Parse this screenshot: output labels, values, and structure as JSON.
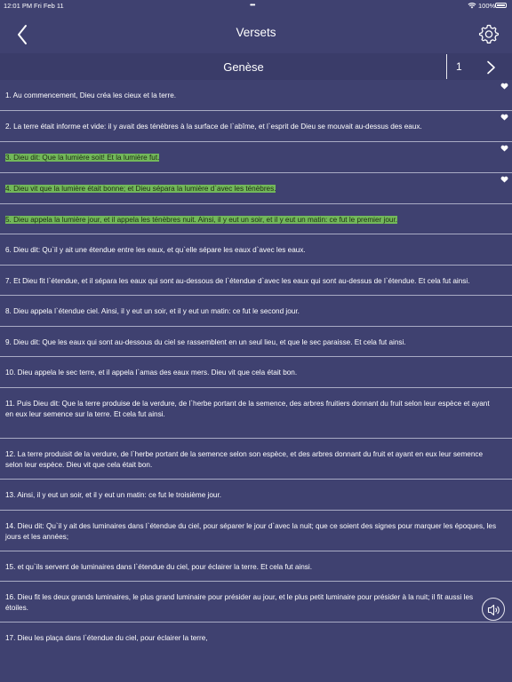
{
  "status_bar": {
    "time": "12:01 PM",
    "date": "Fri Feb 11",
    "battery": "100%"
  },
  "header": {
    "title": "Versets",
    "icons": {
      "back": "chevron-left-icon",
      "settings": "gear-icon"
    }
  },
  "selector": {
    "book": "Genèse",
    "chapter": "1",
    "next_icon": "chevron-right-icon"
  },
  "colors": {
    "background": "#3f4170",
    "highlight": "#72b85a",
    "divider": "#a9abc4"
  },
  "verses": [
    {
      "text": "1. Au commencement, Dieu créa les cieux et la terre.",
      "favorite": true,
      "highlighted": false
    },
    {
      "text": "2. La terre était informe et vide: il y avait des ténèbres à la surface de l`abîme, et l`esprit de Dieu se mouvait au-dessus des eaux.",
      "favorite": true,
      "highlighted": false
    },
    {
      "text": "3. Dieu dit: Que la lumière soit! Et la lumière fut.",
      "favorite": true,
      "highlighted": true
    },
    {
      "text": "4. Dieu vit que la lumière était bonne; et Dieu sépara la lumière d`avec les ténèbres.",
      "favorite": true,
      "highlighted": true
    },
    {
      "text": "5. Dieu appela la lumière jour, et il appela les ténèbres nuit. Ainsi, il y eut un soir, et il y eut un matin: ce fut le premier jour.",
      "favorite": false,
      "highlighted": true
    },
    {
      "text": "6. Dieu dit: Qu`il y ait une étendue entre les eaux, et qu`elle sépare les eaux d`avec les eaux.",
      "favorite": false,
      "highlighted": false
    },
    {
      "text": "7. Et Dieu fit l`étendue, et il sépara les eaux qui sont au-dessous de l`étendue d`avec les eaux qui sont au-dessus de l`étendue. Et cela fut ainsi.",
      "favorite": false,
      "highlighted": false
    },
    {
      "text": "8. Dieu appela l`étendue ciel. Ainsi, il y eut un soir, et il y eut un matin: ce fut le second jour.",
      "favorite": false,
      "highlighted": false
    },
    {
      "text": "9. Dieu dit: Que les eaux qui sont au-dessous du ciel se rassemblent en un seul lieu, et que le sec paraisse. Et cela fut ainsi.",
      "favorite": false,
      "highlighted": false
    },
    {
      "text": "10. Dieu appela le sec terre, et il appela l`amas des eaux mers. Dieu vit que cela était bon.",
      "favorite": false,
      "highlighted": false
    },
    {
      "text": "11. Puis Dieu dit: Que la terre produise de la verdure, de l`herbe portant de la semence, des arbres fruitiers donnant du fruit selon leur espèce et ayant en eux leur semence sur la terre. Et cela fut ainsi.",
      "favorite": false,
      "highlighted": false
    },
    {
      "text": "12. La terre produisit de la verdure, de l`herbe portant de la semence selon son espèce, et des arbres donnant du fruit et ayant en eux leur semence selon leur espèce. Dieu vit que cela était bon.",
      "favorite": false,
      "highlighted": false
    },
    {
      "text": "13. Ainsi, il y eut un soir, et il y eut un matin: ce fut le troisième jour.",
      "favorite": false,
      "highlighted": false
    },
    {
      "text": "14. Dieu dit: Qu`il y ait des luminaires dans l`étendue du ciel, pour séparer le jour d`avec la nuit; que ce soient des signes pour marquer les époques, les jours et les années;",
      "favorite": false,
      "highlighted": false
    },
    {
      "text": "15. et qu`ils servent de luminaires dans l`étendue du ciel, pour éclairer la terre. Et cela fut ainsi.",
      "favorite": false,
      "highlighted": false
    },
    {
      "text": "16. Dieu fit les deux grands luminaires, le plus grand luminaire pour présider au jour, et le plus petit luminaire pour présider à la nuit; il fit aussi les étoiles.",
      "favorite": false,
      "highlighted": false
    },
    {
      "text": "17. Dieu les plaça dans l`étendue du ciel, pour éclairer la terre,",
      "favorite": false,
      "highlighted": false
    }
  ],
  "speaker_icon": "speaker-icon"
}
